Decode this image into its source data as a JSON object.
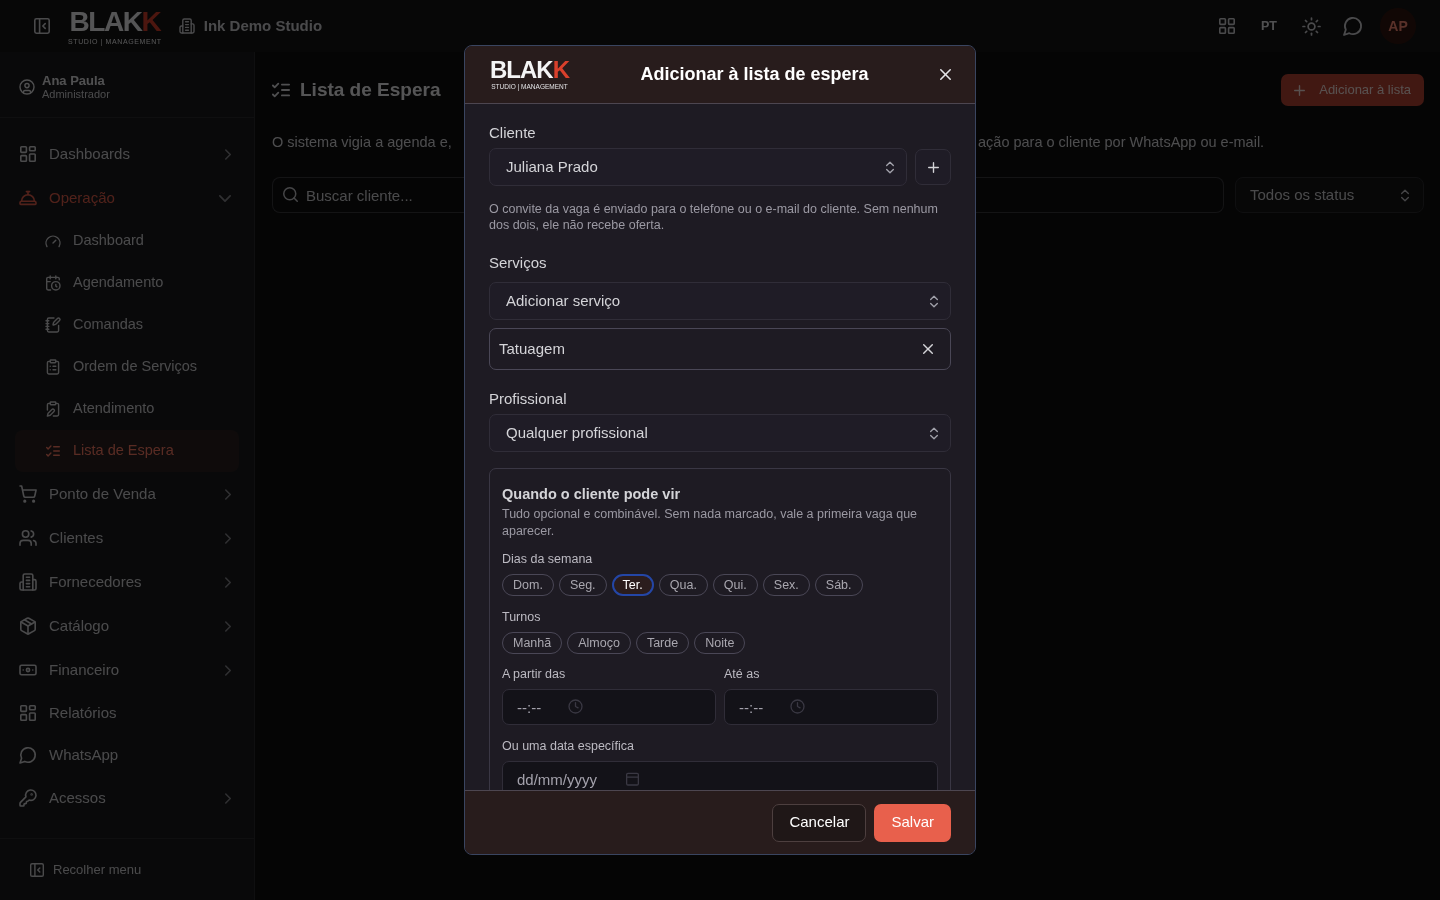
{
  "topbar": {
    "logo": {
      "wordmark": "BLAK",
      "wordmark_accent": "K",
      "tagline": "STUDIO | MANAGEMENT"
    },
    "studio": "Ink Demo Studio",
    "language": "PT",
    "avatar": "AP"
  },
  "sidebar": {
    "user": {
      "name": "Ana Paula",
      "role": "Administrador"
    },
    "items": [
      {
        "label": "Dashboards",
        "kind": "group",
        "expanded": false,
        "selected": false
      },
      {
        "label": "Operação",
        "kind": "group",
        "expanded": true,
        "selected": true,
        "children": [
          {
            "label": "Dashboard",
            "selected": false
          },
          {
            "label": "Agendamento",
            "selected": false
          },
          {
            "label": "Comandas",
            "selected": false
          },
          {
            "label": "Ordem de Serviços",
            "selected": false
          },
          {
            "label": "Atendimento",
            "selected": false
          },
          {
            "label": "Lista de Espera",
            "selected": true
          }
        ]
      },
      {
        "label": "Ponto de Venda",
        "kind": "group",
        "expanded": false,
        "selected": false
      },
      {
        "label": "Clientes",
        "kind": "group",
        "expanded": false,
        "selected": false
      },
      {
        "label": "Fornecedores",
        "kind": "group",
        "expanded": false,
        "selected": false
      },
      {
        "label": "Catálogo",
        "kind": "group",
        "expanded": false,
        "selected": false
      },
      {
        "label": "Financeiro",
        "kind": "group",
        "expanded": false,
        "selected": false
      },
      {
        "label": "Relatórios",
        "kind": "link",
        "selected": false
      },
      {
        "label": "WhatsApp",
        "kind": "link",
        "selected": false
      },
      {
        "label": "Acessos",
        "kind": "group",
        "expanded": false,
        "selected": false
      }
    ],
    "collapse": "Recolher menu"
  },
  "page": {
    "title": "Lista de Espera",
    "add_button": "Adicionar à lista",
    "description": [
      "O sistema vigia a agenda e,",
      "ação para o cliente por WhatsApp ou e-mail."
    ],
    "search": {
      "placeholder": "Buscar cliente..."
    },
    "status_filter": {
      "value": "Todos os status"
    }
  },
  "modal": {
    "logo": {
      "wordmark": "BLAK",
      "wordmark_accent": "K",
      "tagline": "STUDIO | MANAGEMENT"
    },
    "title": "Adicionar à lista de espera",
    "client": {
      "label": "Cliente",
      "value": "Juliana Prado",
      "help": "O convite da vaga é enviado para o telefone ou o e-mail do cliente. Sem nenhum dos dois, ele não recebe oferta."
    },
    "services": {
      "label": "Serviços",
      "value": "Adicionar serviço",
      "items": [
        {
          "label": "Tatuagem"
        }
      ]
    },
    "professional": {
      "label": "Profissional",
      "value": "Qualquer profissional"
    },
    "availability": {
      "title": "Quando o cliente pode vir",
      "description": "Tudo opcional e combinável. Sem nada marcado, vale a primeira vaga que aparecer.",
      "days_label": "Dias da semana",
      "days": [
        {
          "label": "Dom.",
          "selected": false,
          "focused": false
        },
        {
          "label": "Seg.",
          "selected": false,
          "focused": false
        },
        {
          "label": "Ter.",
          "selected": true,
          "focused": true
        },
        {
          "label": "Qua.",
          "selected": false,
          "focused": false
        },
        {
          "label": "Qui.",
          "selected": false,
          "focused": false
        },
        {
          "label": "Sex.",
          "selected": false,
          "focused": false
        },
        {
          "label": "Sáb.",
          "selected": false,
          "focused": false
        }
      ],
      "shifts_label": "Turnos",
      "shifts": [
        {
          "label": "Manhã",
          "selected": false
        },
        {
          "label": "Almoço",
          "selected": false
        },
        {
          "label": "Tarde",
          "selected": false
        },
        {
          "label": "Noite",
          "selected": false
        }
      ],
      "from": {
        "label": "A partir das",
        "placeholder": "--:--"
      },
      "until": {
        "label": "Até as",
        "placeholder": "--:--"
      },
      "date": {
        "label": "Ou uma data específica",
        "placeholder": "dd/mm/yyyy"
      }
    },
    "footer": {
      "cancel": "Cancelar",
      "save": "Salvar"
    }
  }
}
